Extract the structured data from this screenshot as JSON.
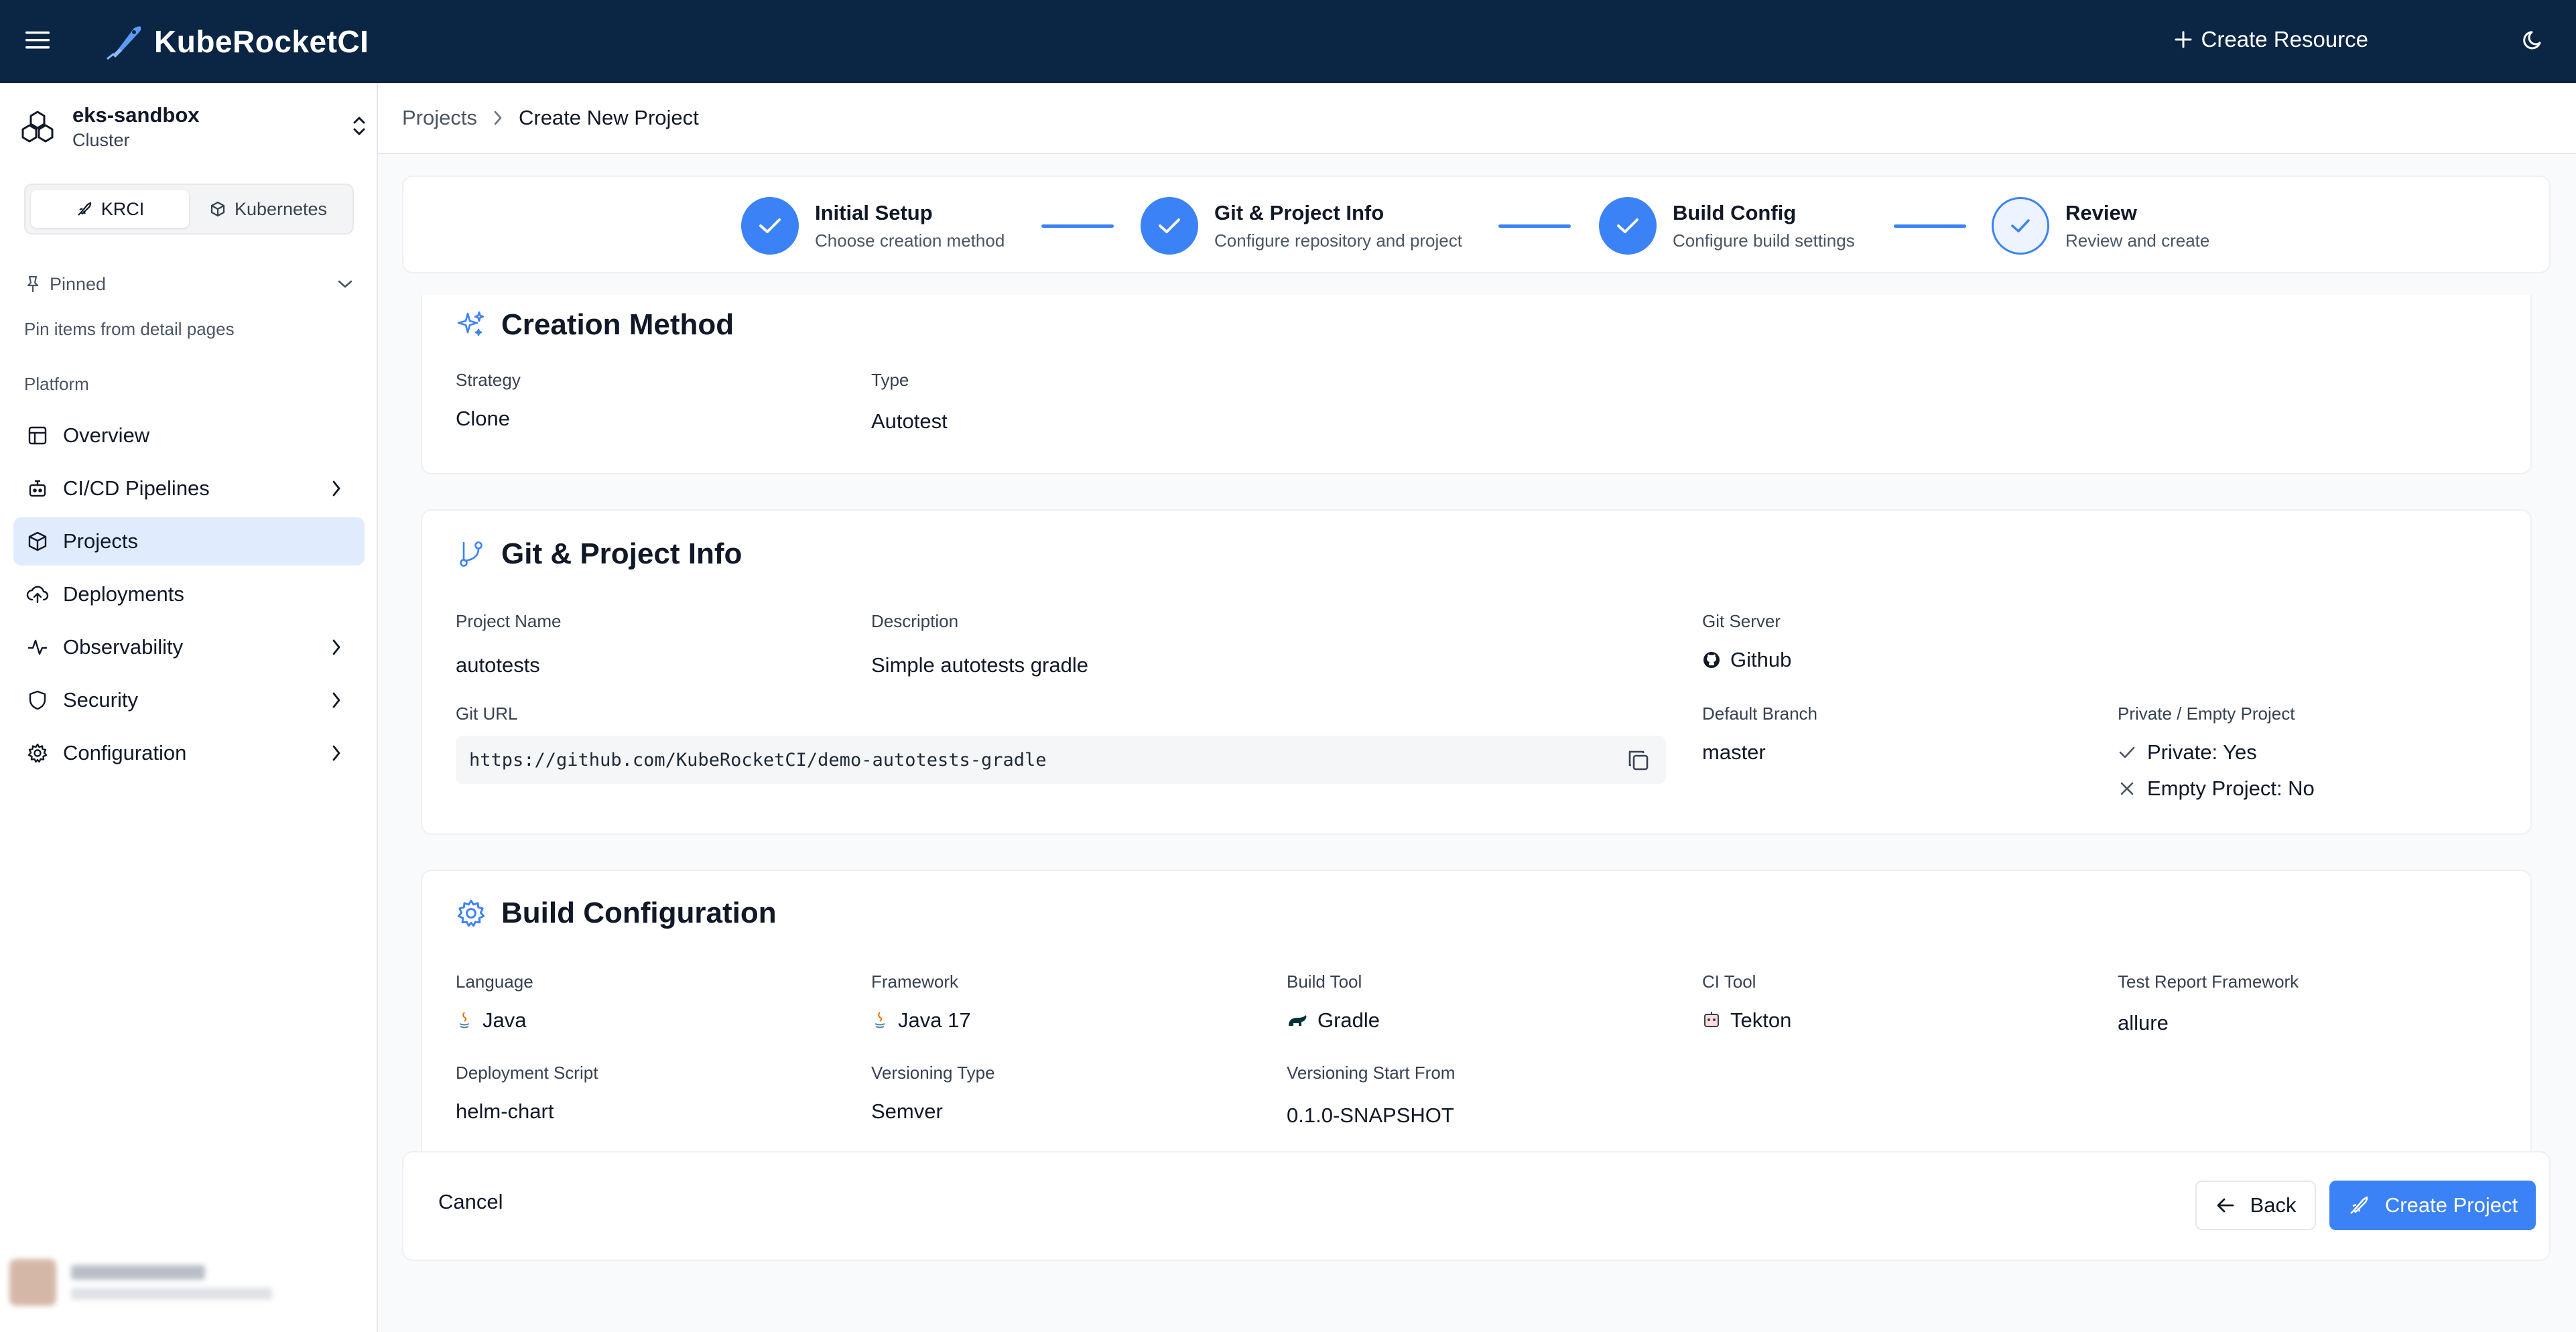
{
  "app": {
    "title": "KubeRocketCI"
  },
  "topbar": {
    "create_resource_label": "Create Resource"
  },
  "sidebar": {
    "cluster_name": "eks-sandbox",
    "cluster_sub": "Cluster",
    "seg_krci": "KRCI",
    "seg_kubernetes": "Kubernetes",
    "pinned_label": "Pinned",
    "pinned_hint": "Pin items from detail pages",
    "platform_label": "Platform",
    "items": [
      {
        "label": "Overview"
      },
      {
        "label": "CI/CD Pipelines"
      },
      {
        "label": "Projects"
      },
      {
        "label": "Deployments"
      },
      {
        "label": "Observability"
      },
      {
        "label": "Security"
      },
      {
        "label": "Configuration"
      }
    ]
  },
  "breadcrumb": {
    "parent": "Projects",
    "current": "Create New Project"
  },
  "stepper": {
    "steps": [
      {
        "title": "Initial Setup",
        "sub": "Choose creation method"
      },
      {
        "title": "Git & Project Info",
        "sub": "Configure repository and project"
      },
      {
        "title": "Build Config",
        "sub": "Configure build settings"
      },
      {
        "title": "Review",
        "sub": "Review and create"
      }
    ]
  },
  "creation": {
    "title": "Creation Method",
    "strategy_label": "Strategy",
    "strategy": "Clone",
    "type_label": "Type",
    "type": "Autotest"
  },
  "git": {
    "title": "Git & Project Info",
    "name_label": "Project Name",
    "name": "autotests",
    "desc_label": "Description",
    "desc": "Simple autotests gradle",
    "server_label": "Git Server",
    "server": "Github",
    "url_label": "Git URL",
    "url": "https://github.com/KubeRocketCI/demo-autotests-gradle",
    "branch_label": "Default Branch",
    "branch": "master",
    "pe_label": "Private / Empty Project",
    "private": "Private: Yes",
    "empty": "Empty Project: No"
  },
  "build": {
    "title": "Build Configuration",
    "lang_label": "Language",
    "lang": "Java",
    "fw_label": "Framework",
    "fw": "Java 17",
    "tool_label": "Build Tool",
    "tool": "Gradle",
    "ci_label": "CI Tool",
    "ci": "Tekton",
    "trf_label": "Test Report Framework",
    "trf": "allure",
    "ds_label": "Deployment Script",
    "ds": "helm-chart",
    "vt_label": "Versioning Type",
    "vt": "Semver",
    "vsf_label": "Versioning Start From",
    "vsf": "0.1.0-SNAPSHOT"
  },
  "footer": {
    "cancel": "Cancel",
    "back": "Back",
    "create": "Create Project"
  },
  "colors": {
    "topbar": "#0b2545",
    "accent": "#3b82f6",
    "active_nav": "#e0ecfd"
  }
}
